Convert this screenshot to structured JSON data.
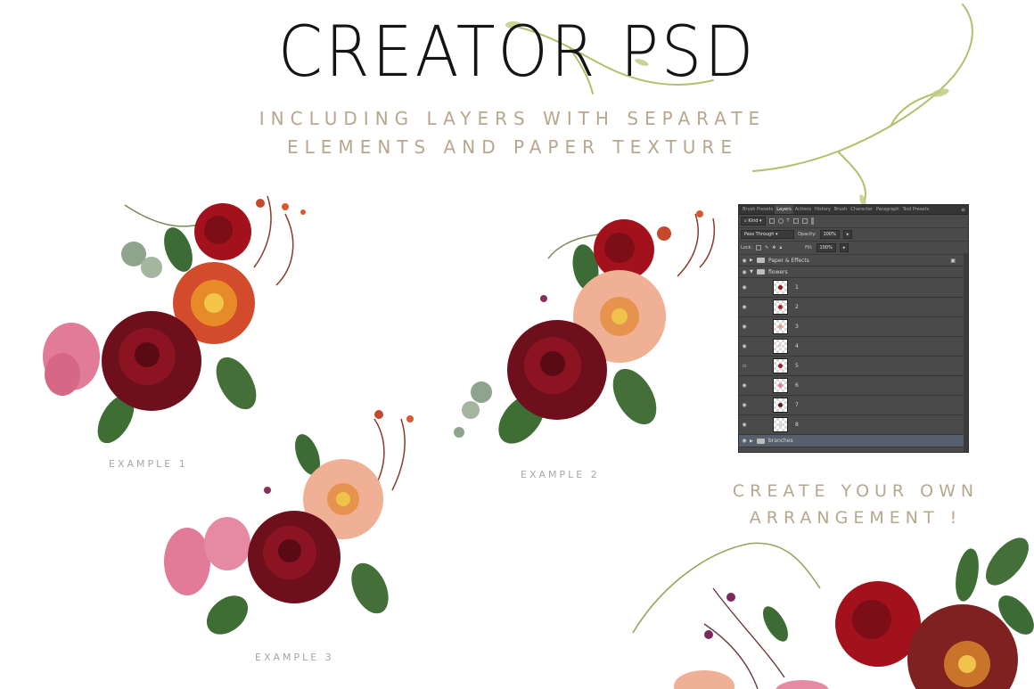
{
  "header": {
    "title": "CREATOR PSD",
    "subtitle_line1": "INCLUDING LAYERS WITH SEPARATE",
    "subtitle_line2": "ELEMENTS AND PAPER TEXTURE"
  },
  "examples": [
    {
      "label": "EXAMPLE 1"
    },
    {
      "label": "EXAMPLE 2"
    },
    {
      "label": "EXAMPLE 3"
    }
  ],
  "cta": {
    "line1": "CREATE YOUR OWN",
    "line2": "ARRANGEMENT !"
  },
  "layers_panel": {
    "tabs": [
      "Brush Presets",
      "Layers",
      "Actions",
      "History",
      "Brush",
      "Character",
      "Paragraph",
      "Tool Presets"
    ],
    "active_tab": "Layers",
    "filter_label": "Kind",
    "blend_mode": "Pass Through",
    "opacity_label": "Opacity:",
    "opacity_value": "100%",
    "lock_label": "Lock:",
    "fill_label": "Fill:",
    "fill_value": "100%",
    "groups": {
      "paper": "Paper & Effects",
      "flowers": "flowers",
      "branches": "branches"
    },
    "layers": [
      "1",
      "2",
      "3",
      "4",
      "5",
      "6",
      "7",
      "8"
    ]
  },
  "colors": {
    "title": "#141414",
    "subtitle": "#b6a88e",
    "caption": "#a7a7a7",
    "rose_dark": "#6e0f1c",
    "rose_red": "#a3121c",
    "pink": "#e27b98",
    "peach": "#efb095",
    "leaf": "#3d6b35",
    "vine": "#a7b560"
  }
}
